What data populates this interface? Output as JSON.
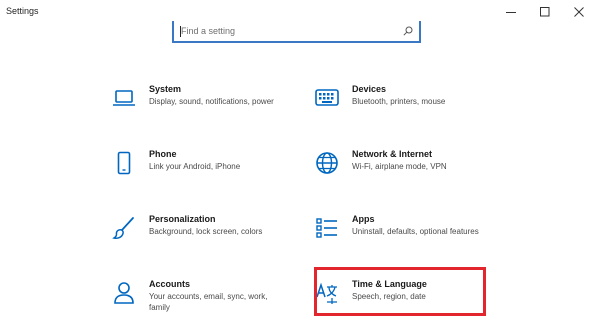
{
  "window": {
    "title": "Settings",
    "minimize_icon": "minimize-icon",
    "maximize_icon": "maximize-icon",
    "close_icon": "close-icon"
  },
  "search": {
    "placeholder": "Find a setting",
    "value": "",
    "icon": "search-icon"
  },
  "accent_color": "#0067c0",
  "highlight_color": "#e3262d",
  "tiles": [
    {
      "title": "System",
      "description": "Display, sound, notifications, power",
      "icon": "laptop-icon"
    },
    {
      "title": "Devices",
      "description": "Bluetooth, printers, mouse",
      "icon": "keyboard-icon"
    },
    {
      "title": "Phone",
      "description": "Link your Android, iPhone",
      "icon": "phone-icon"
    },
    {
      "title": "Network & Internet",
      "description": "Wi-Fi, airplane mode, VPN",
      "icon": "globe-icon"
    },
    {
      "title": "Personalization",
      "description": "Background, lock screen, colors",
      "icon": "brush-icon"
    },
    {
      "title": "Apps",
      "description": "Uninstall, defaults, optional features",
      "icon": "apps-list-icon"
    },
    {
      "title": "Accounts",
      "description": "Your accounts, email, sync, work, family",
      "icon": "person-icon"
    },
    {
      "title": "Time & Language",
      "description": "Speech, region, date",
      "icon": "time-language-icon"
    }
  ]
}
